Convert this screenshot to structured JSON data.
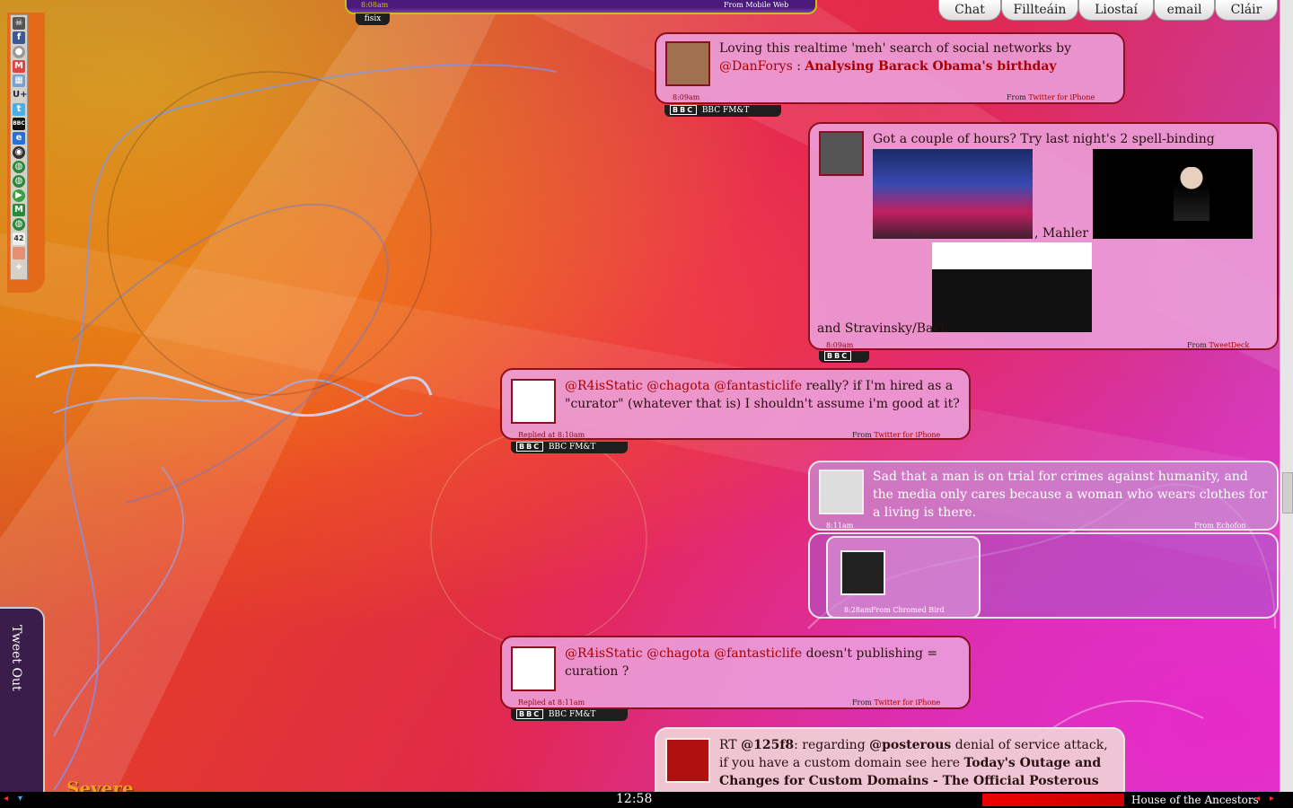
{
  "nav": [
    "Chat",
    "Fillteáin",
    "Liostaí",
    "email",
    "Cláir"
  ],
  "top_tweet": {
    "time": "8:08am",
    "from": "From Mobile Web",
    "user": "fisix"
  },
  "tweets": [
    {
      "text_pre": "Loving this realtime 'meh' search of social networks by ",
      "mention": "@DanForys",
      "text_mid": " : ",
      "link": "Analysing Barack Obama's birthday",
      "time": "8:09am",
      "from_label": "From",
      "from_app": "Twitter for iPhone",
      "bbc": "BBC",
      "source_tag": "BBC FM&T"
    },
    {
      "text_pre": "Got a couple of hours? Try last night's 2 spell-binding",
      "caption1": ", Mahler 3",
      "caption2": "and Stravinsky/Bach",
      "time": "8:09am",
      "from_label": "From",
      "from_app": "TweetDeck",
      "bbc": "BBC"
    },
    {
      "mentions": "@R4isStatic @chagota @fantasticlife",
      "text": " really? if I'm hired as a \"curator\" (whatever that is) I shouldn't assume i'm good at it?",
      "time": "Replied at 8:10am",
      "from_label": "From",
      "from_app": "Twitter for iPhone",
      "bbc": "BBC",
      "source_tag": "BBC FM&T"
    },
    {
      "text": "Sad that a man is on trial for crimes against humanity, and the media only cares because a woman who wears clothes for a living is there.",
      "time": "8:11am",
      "from_label": "From",
      "from_app": "Echofon"
    },
    {
      "time": "8:28am",
      "from_label": "From",
      "from_app": "Chromed Bird"
    },
    {
      "mentions": "@R4isStatic @chagota @fantasticlife",
      "text": " doesn't publishing = curation ?",
      "time": "Replied at 8:11am",
      "from_label": "From",
      "from_app": "Twitter for iPhone",
      "bbc": "BBC",
      "source_tag": "BBC FM&T"
    },
    {
      "rt": "RT ",
      "mention1": "@125f8",
      "text1": ": regarding ",
      "mention2": "@posterous",
      "text2": " denial of service attack, if you have a custom domain see here ",
      "link": "Today's Outage and Changes for Custom Domains - The Official Posterous Posterous"
    }
  ],
  "left_icons": [
    "skull-icon",
    "facebook-icon",
    "circle-icon",
    "gmail-icon",
    "calendar-icon",
    "uplus-icon",
    "twitter-icon",
    "bbc-icon",
    "ie-icon",
    "chrome-icon",
    "globe-icon",
    "globe-icon",
    "play-icon",
    "m-icon",
    "globe-icon",
    "calendar-42-icon",
    "blank-icon",
    "plus-icon"
  ],
  "left_icon_labels": {
    "uplus": "U+",
    "bbc": "BBC",
    "m": "M",
    "cal42": "42",
    "plus": "+"
  },
  "tweet_out": "Tweet Out",
  "weather": "Severe",
  "clock": "12:58",
  "now_playing": "House of the Ancestors"
}
